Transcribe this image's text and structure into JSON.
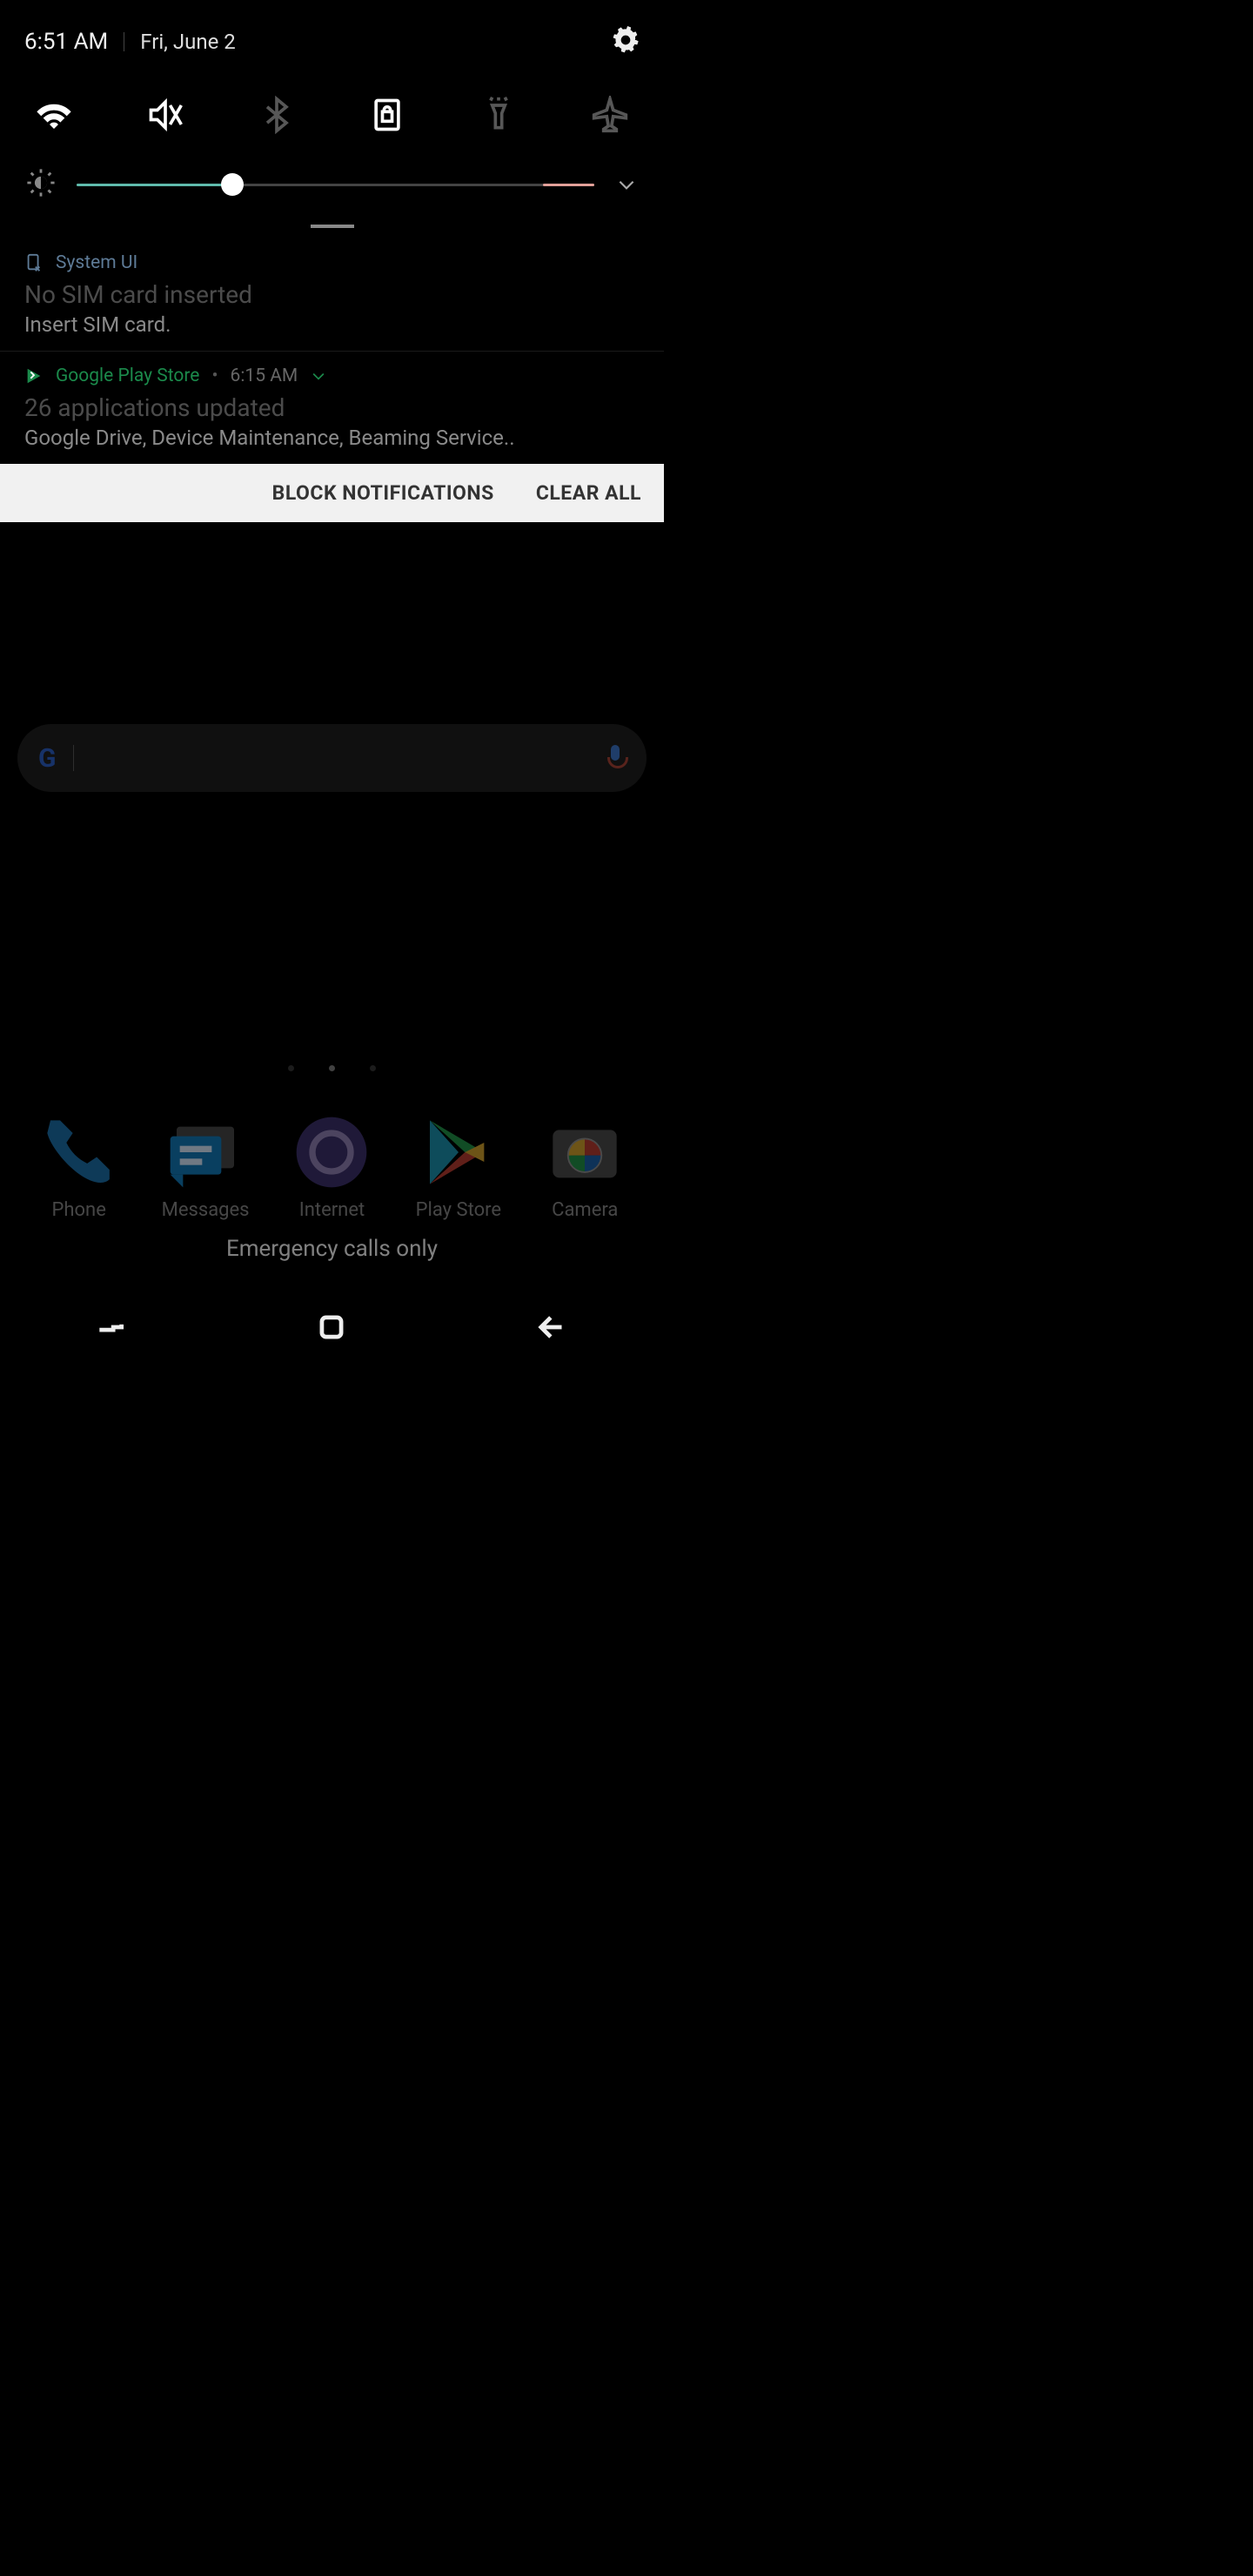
{
  "status": {
    "time": "6:51 AM",
    "date": "Fri, June 2"
  },
  "quick_toggles": {
    "wifi_active": true,
    "sound_active": true,
    "bluetooth_active": false,
    "orientation_active": true,
    "flashlight_active": false,
    "airplane_active": false
  },
  "brightness": {
    "percent": 30,
    "pink_end_percent": 10
  },
  "notifications": [
    {
      "app": "System UI",
      "title": "No SIM card inserted",
      "body": "Insert SIM card."
    },
    {
      "app": "Google Play Store",
      "time": "6:15 AM",
      "title": "26 applications updated",
      "body": "Google Drive, Device Maintenance, Beaming Service.."
    }
  ],
  "notif_actions": {
    "block": "BLOCK NOTIFICATIONS",
    "clear": "CLEAR ALL"
  },
  "dock": {
    "apps": [
      {
        "label": "Phone"
      },
      {
        "label": "Messages"
      },
      {
        "label": "Internet"
      },
      {
        "label": "Play Store"
      },
      {
        "label": "Camera"
      }
    ]
  },
  "toast": "Emergency calls only"
}
